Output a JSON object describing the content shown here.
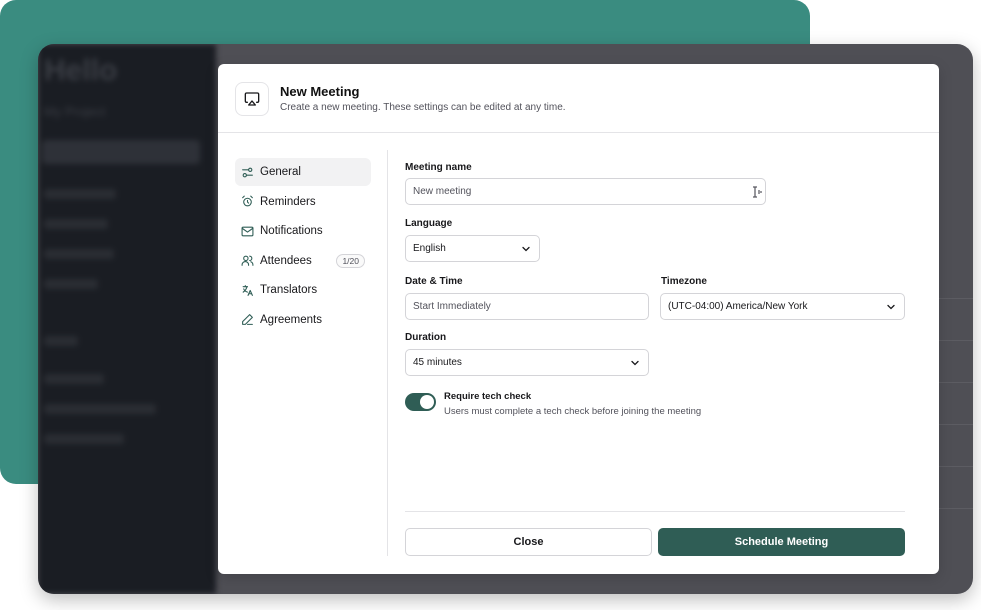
{
  "background_app": {
    "brand": "Hello",
    "project": "My Project"
  },
  "modal": {
    "title": "New Meeting",
    "subtitle": "Create a new meeting. These settings can be edited at any time.",
    "header_icon": "screen-cast-icon"
  },
  "nav": {
    "items": [
      {
        "label": "General",
        "icon": "sliders-icon",
        "active": true
      },
      {
        "label": "Reminders",
        "icon": "alarm-clock-icon"
      },
      {
        "label": "Notifications",
        "icon": "mail-icon"
      },
      {
        "label": "Attendees",
        "icon": "users-icon",
        "badge": "1/20"
      },
      {
        "label": "Translators",
        "icon": "translate-icon"
      },
      {
        "label": "Agreements",
        "icon": "pen-icon"
      }
    ]
  },
  "form": {
    "meeting_name": {
      "label": "Meeting name",
      "value": "New meeting"
    },
    "language": {
      "label": "Language",
      "value": "English"
    },
    "date_time": {
      "label": "Date & Time",
      "placeholder": "Start Immediately"
    },
    "timezone": {
      "label": "Timezone",
      "value": "(UTC-04:00) America/New York"
    },
    "duration": {
      "label": "Duration",
      "value": "45 minutes"
    },
    "tech_check": {
      "title": "Require tech check",
      "description": "Users must complete a tech check before joining the meeting",
      "enabled": true
    }
  },
  "footer": {
    "close_label": "Close",
    "schedule_label": "Schedule Meeting"
  },
  "colors": {
    "accent": "#2f5d55",
    "teal_background": "#3a8c80"
  }
}
